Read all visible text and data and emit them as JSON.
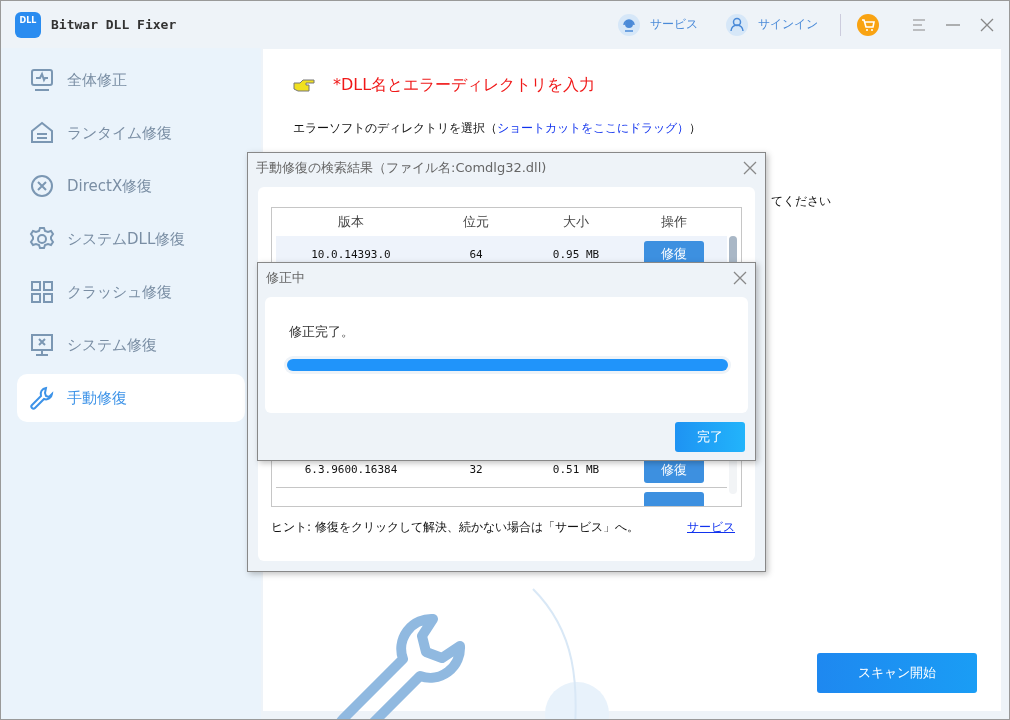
{
  "window": {
    "title": "Bitwar DLL Fixer",
    "logo": "DLL"
  },
  "header": {
    "service": "サービス",
    "signin": "サインイン"
  },
  "sidebar": {
    "items": [
      {
        "label": "全体修正",
        "kind": "overview",
        "selected": false
      },
      {
        "label": "ランタイム修復",
        "kind": "runtime",
        "selected": false
      },
      {
        "label": "DirectX修復",
        "kind": "directx",
        "selected": false
      },
      {
        "label": "システムDLL修復",
        "kind": "systemdll",
        "selected": false
      },
      {
        "label": "クラッシュ修復",
        "kind": "crash",
        "selected": false
      },
      {
        "label": "システム修復",
        "kind": "system",
        "selected": false
      },
      {
        "label": "手動修復",
        "kind": "manual",
        "selected": true
      }
    ]
  },
  "content": {
    "heading": "*DLL名とエラーディレクトリを入力",
    "directory_label": "エラーソフトのディレクトリを選択（",
    "directory_link": "ショートカットをここにドラッグ）",
    "directory_end": "）",
    "partial_text": "てください",
    "scan_button": "スキャン開始"
  },
  "results_dialog": {
    "title": "手動修復の検索結果（ファイル名:Comdlg32.dll)",
    "columns": [
      "版本",
      "位元",
      "大小",
      "操作"
    ],
    "rows": [
      {
        "kind": "full",
        "version": "10.0.14393.0",
        "bits": "64",
        "size": "0.95 MB",
        "action": "修復",
        "selected": true
      },
      {
        "kind": "full",
        "version": "6.3.9600.16384",
        "bits": "32",
        "size": "0.51 MB",
        "action": "修復",
        "selected": false
      },
      {
        "kind": "partial",
        "selected": false
      }
    ],
    "hint": "ヒント: 修復をクリックして解決、続かない場合は「サービス」へ。",
    "hint_link": "サービス"
  },
  "progress_dialog": {
    "title": "修正中",
    "message": "修正完了。",
    "level": 1,
    "button": "完了"
  }
}
